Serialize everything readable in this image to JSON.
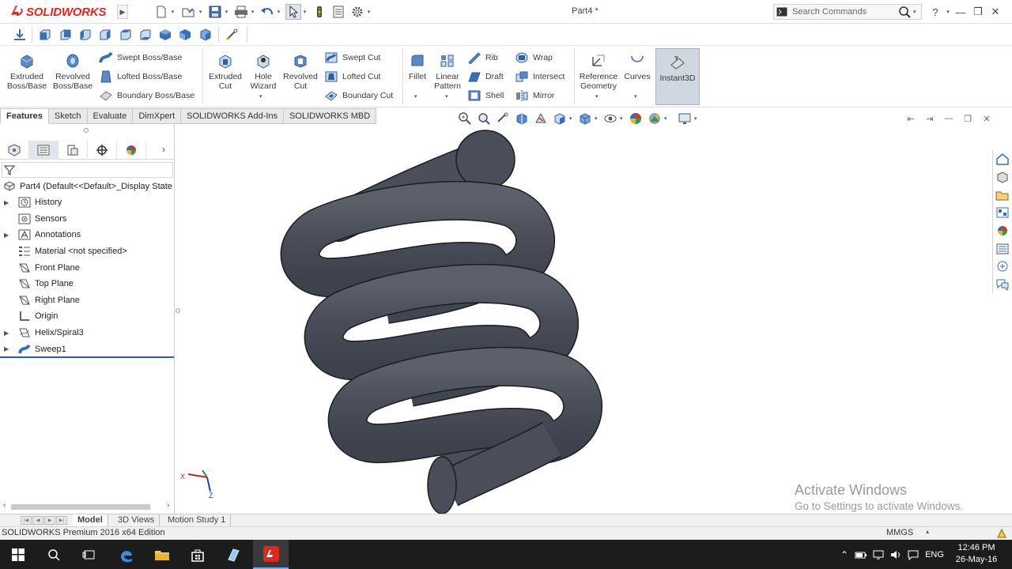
{
  "app": {
    "brand": "SOLIDWORKS",
    "document_title": "Part4 *"
  },
  "search": {
    "placeholder": "Search Commands"
  },
  "title_icons": [
    "new-document-icon",
    "open-folder-icon",
    "save-icon",
    "print-icon",
    "undo-icon",
    "select-pointer-icon",
    "rebuild-icon",
    "file-properties-icon",
    "options-gear-icon"
  ],
  "ribbon": {
    "extruded_boss": "Extruded\nBoss/Base",
    "revolved_boss": "Revolved\nBoss/Base",
    "swept_boss": "Swept Boss/Base",
    "lofted_boss": "Lofted Boss/Base",
    "boundary_boss": "Boundary Boss/Base",
    "extruded_cut": "Extruded\nCut",
    "hole_wizard": "Hole\nWizard",
    "revolved_cut": "Revolved\nCut",
    "swept_cut": "Swept Cut",
    "lofted_cut": "Lofted Cut",
    "boundary_cut": "Boundary Cut",
    "fillet": "Fillet",
    "linear_pattern": "Linear\nPattern",
    "rib": "Rib",
    "draft": "Draft",
    "shell": "Shell",
    "wrap": "Wrap",
    "intersect": "Intersect",
    "mirror": "Mirror",
    "reference_geometry": "Reference\nGeometry",
    "curves": "Curves",
    "instant3d": "Instant3D"
  },
  "command_tabs": [
    "Features",
    "Sketch",
    "Evaluate",
    "DimXpert",
    "SOLIDWORKS Add-Ins",
    "SOLIDWORKS MBD"
  ],
  "feature_manager": {
    "part_label": "Part4  (Default<<Default>_Display State",
    "items": [
      "History",
      "Sensors",
      "Annotations",
      "Material <not specified>",
      "Front Plane",
      "Top Plane",
      "Right Plane",
      "Origin",
      "Helix/Spiral3",
      "Sweep1"
    ]
  },
  "triad": {
    "x": "X",
    "y": "Y",
    "z": "Z"
  },
  "bottom_tabs": [
    "Model",
    "3D Views",
    "Motion Study 1"
  ],
  "status": {
    "edition": "SOLIDWORKS Premium 2016 x64 Edition",
    "units": "MMGS"
  },
  "watermark": {
    "line1": "Activate Windows",
    "line2": "Go to Settings to activate Windows."
  },
  "taskbar": {
    "language": "ENG",
    "time": "12:46 PM",
    "date": "26-May-16"
  },
  "colors": {
    "brand_red": "#da291c",
    "spring_body": "#4a4e59",
    "taskbar": "#1c1c1c",
    "accent_blue": "#2c5fa8"
  }
}
